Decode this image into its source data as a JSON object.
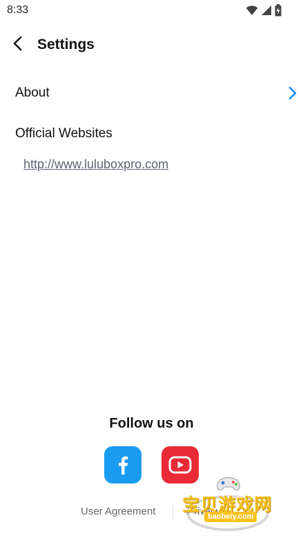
{
  "status_bar": {
    "time": "8:33"
  },
  "header": {
    "title": "Settings"
  },
  "about": {
    "label": "About"
  },
  "websites": {
    "label": "Official Websites",
    "url": "http://www.luluboxpro.com"
  },
  "footer": {
    "follow_title": "Follow us on",
    "user_agreement": "User Agreement",
    "privacy": "Privacy"
  },
  "watermark": {
    "text": "宝贝游戏网",
    "domain": "baobeiy.com"
  },
  "colors": {
    "accent": "#1a8cff",
    "facebook": "#1a9bf0",
    "youtube": "#ea2a36",
    "link": "#5a6275"
  },
  "icons": [
    "wifi-icon",
    "signal-icon",
    "battery-icon",
    "back-arrow-icon",
    "chevron-right-icon",
    "facebook-icon",
    "youtube-icon"
  ]
}
